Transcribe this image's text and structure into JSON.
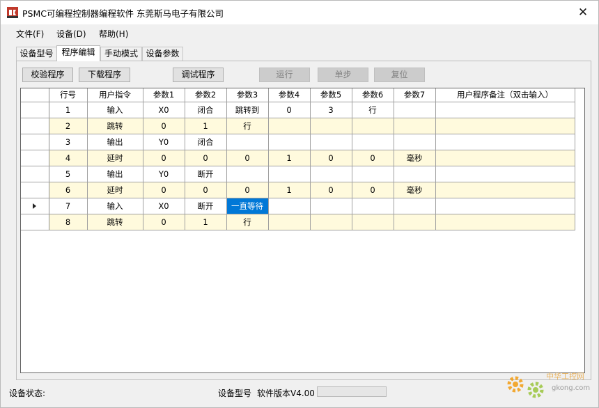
{
  "window": {
    "title": "PSMC可编程控制器编程软件 东莞斯马电子有限公司"
  },
  "menu": [
    {
      "label": "文件(F)"
    },
    {
      "label": "设备(D)"
    },
    {
      "label": "帮助(H)"
    }
  ],
  "tabs": [
    {
      "label": "设备型号"
    },
    {
      "label": "程序编辑"
    },
    {
      "label": "手动模式"
    },
    {
      "label": "设备参数"
    }
  ],
  "toolbar": {
    "verify_label": "校验程序",
    "download_label": "下载程序",
    "debug_label": "调试程序",
    "run_label": "运行",
    "step_label": "单步",
    "reset_label": "复位"
  },
  "table": {
    "columns": [
      "行号",
      "用户指令",
      "参数1",
      "参数2",
      "参数3",
      "参数4",
      "参数5",
      "参数6",
      "参数7",
      "用户程序备注（双击输入）"
    ],
    "rows": [
      [
        "1",
        "输入",
        "X0",
        "闭合",
        "跳转到",
        "0",
        "3",
        "行",
        "",
        ""
      ],
      [
        "2",
        "跳转",
        "0",
        "1",
        "行",
        "",
        "",
        "",
        "",
        ""
      ],
      [
        "3",
        "输出",
        "Y0",
        "闭合",
        "",
        "",
        "",
        "",
        "",
        ""
      ],
      [
        "4",
        "延时",
        "0",
        "0",
        "0",
        "1",
        "0",
        "0",
        "毫秒",
        ""
      ],
      [
        "5",
        "输出",
        "Y0",
        "断开",
        "",
        "",
        "",
        "",
        "",
        ""
      ],
      [
        "6",
        "延时",
        "0",
        "0",
        "0",
        "1",
        "0",
        "0",
        "毫秒",
        ""
      ],
      [
        "7",
        "输入",
        "X0",
        "断开",
        "一直等待",
        "",
        "",
        "",
        "",
        ""
      ],
      [
        "8",
        "跳转",
        "0",
        "1",
        "行",
        "",
        "",
        "",
        "",
        ""
      ]
    ],
    "current_row": 7,
    "selected_cell": {
      "row": 7,
      "col": 5
    }
  },
  "status": {
    "state_label": "设备状态:",
    "device_label": "设备型号",
    "version_label": "软件版本V4.00",
    "progress": 0
  },
  "watermark": {
    "brand": "中华工控网",
    "site": "gkong.com"
  },
  "colors": {
    "alt_row": "#fffadd",
    "selection": "#0078d7"
  }
}
